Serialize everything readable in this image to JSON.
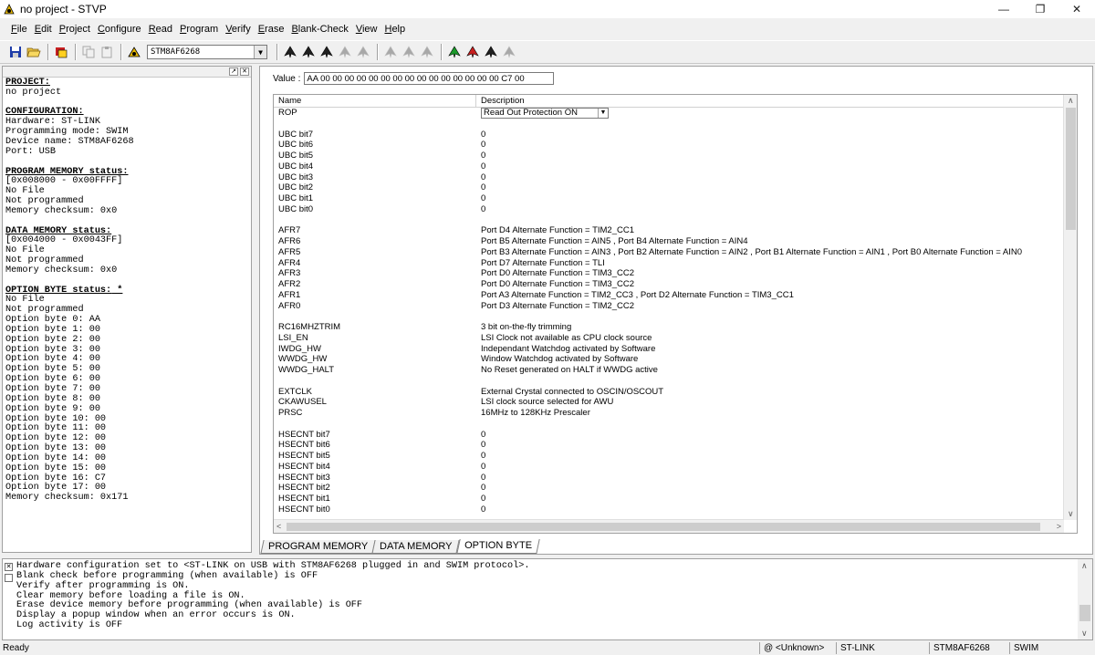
{
  "window": {
    "title": "no project - STVP"
  },
  "menu": [
    "File",
    "Edit",
    "Project",
    "Configure",
    "Read",
    "Program",
    "Verify",
    "Erase",
    "Blank-Check",
    "View",
    "Help"
  ],
  "toolbar": {
    "device": "STM8AF6268"
  },
  "left_panel": {
    "sections": [
      {
        "title": "PROJECT:",
        "lines": [
          "no project"
        ]
      },
      {
        "title": "CONFIGURATION:",
        "lines": [
          "Hardware: ST-LINK",
          "Programming mode: SWIM",
          "Device name: STM8AF6268",
          "Port: USB"
        ]
      },
      {
        "title": "PROGRAM MEMORY status:",
        "lines": [
          "[0x008000 - 0x00FFFF]",
          "No File",
          "Not programmed",
          "Memory checksum: 0x0"
        ]
      },
      {
        "title": "DATA MEMORY status:",
        "lines": [
          "[0x004000 - 0x0043FF]",
          "No File",
          "Not programmed",
          "Memory checksum: 0x0"
        ]
      },
      {
        "title": "OPTION BYTE status:",
        "suffix": " *",
        "lines": [
          "No File",
          "Not programmed",
          "Option byte 0: AA",
          "Option byte 1: 00",
          "Option byte 2: 00",
          "Option byte 3: 00",
          "Option byte 4: 00",
          "Option byte 5: 00",
          "Option byte 6: 00",
          "Option byte 7: 00",
          "Option byte 8: 00",
          "Option byte 9: 00",
          "Option byte 10: 00",
          "Option byte 11: 00",
          "Option byte 12: 00",
          "Option byte 13: 00",
          "Option byte 14: 00",
          "Option byte 15: 00",
          "Option byte 16: C7",
          "Option byte 17: 00",
          "Memory checksum: 0x171"
        ]
      }
    ]
  },
  "value_row": {
    "label": "Value :",
    "value": "AA 00 00 00 00 00 00 00 00 00 00 00 00 00 00 00 C7 00"
  },
  "table": {
    "col_name": "Name",
    "col_desc": "Description",
    "rows": [
      {
        "name": "ROP",
        "desc": "Read Out Protection ON",
        "select": true
      },
      {
        "name": "",
        "desc": ""
      },
      {
        "name": "UBC bit7",
        "desc": "0"
      },
      {
        "name": "UBC bit6",
        "desc": "0"
      },
      {
        "name": "UBC bit5",
        "desc": "0"
      },
      {
        "name": "UBC bit4",
        "desc": "0"
      },
      {
        "name": "UBC bit3",
        "desc": "0"
      },
      {
        "name": "UBC bit2",
        "desc": "0"
      },
      {
        "name": "UBC bit1",
        "desc": "0"
      },
      {
        "name": "UBC bit0",
        "desc": "0"
      },
      {
        "name": "",
        "desc": ""
      },
      {
        "name": "AFR7",
        "desc": "Port D4 Alternate Function = TIM2_CC1"
      },
      {
        "name": "AFR6",
        "desc": "Port B5 Alternate Function = AIN5 , Port B4 Alternate Function = AIN4"
      },
      {
        "name": "AFR5",
        "desc": "Port B3 Alternate Function = AIN3 , Port B2 Alternate Function = AIN2 , Port B1 Alternate Function = AIN1 , Port B0 Alternate Function = AIN0"
      },
      {
        "name": "AFR4",
        "desc": "Port D7 Alternate Function = TLI"
      },
      {
        "name": "AFR3",
        "desc": "Port D0 Alternate Function = TIM3_CC2"
      },
      {
        "name": "AFR2",
        "desc": "Port D0 Alternate Function = TIM3_CC2"
      },
      {
        "name": "AFR1",
        "desc": "Port A3 Alternate Function = TIM2_CC3 , Port D2 Alternate Function = TIM3_CC1"
      },
      {
        "name": "AFR0",
        "desc": "Port D3 Alternate Function = TIM2_CC2"
      },
      {
        "name": "",
        "desc": ""
      },
      {
        "name": "RC16MHZTRIM",
        "desc": "3 bit on-the-fly trimming"
      },
      {
        "name": "LSI_EN",
        "desc": "LSI Clock not available as CPU clock source"
      },
      {
        "name": "IWDG_HW",
        "desc": "Independant Watchdog activated by Software"
      },
      {
        "name": "WWDG_HW",
        "desc": "Window Watchdog activated by Software"
      },
      {
        "name": "WWDG_HALT",
        "desc": "No Reset generated on HALT if WWDG active"
      },
      {
        "name": "",
        "desc": ""
      },
      {
        "name": "EXTCLK",
        "desc": "External Crystal connected to OSCIN/OSCOUT"
      },
      {
        "name": "CKAWUSEL",
        "desc": "LSI clock source selected for AWU"
      },
      {
        "name": "PRSC",
        "desc": "16MHz to 128KHz Prescaler"
      },
      {
        "name": "",
        "desc": ""
      },
      {
        "name": "HSECNT bit7",
        "desc": "0"
      },
      {
        "name": "HSECNT bit6",
        "desc": "0"
      },
      {
        "name": "HSECNT bit5",
        "desc": "0"
      },
      {
        "name": "HSECNT bit4",
        "desc": "0"
      },
      {
        "name": "HSECNT bit3",
        "desc": "0"
      },
      {
        "name": "HSECNT bit2",
        "desc": "0"
      },
      {
        "name": "HSECNT bit1",
        "desc": "0"
      },
      {
        "name": "HSECNT bit0",
        "desc": "0"
      }
    ]
  },
  "tabs": [
    "PROGRAM MEMORY",
    "DATA MEMORY",
    "OPTION BYTE"
  ],
  "active_tab": "OPTION BYTE",
  "log": [
    "Hardware configuration set to <ST-LINK on USB with STM8AF6268 plugged in and SWIM protocol>.",
    "Blank check before programming (when available) is OFF",
    "Verify after programming is ON.",
    "Clear memory before loading a file is ON.",
    "Erase device memory before programming (when available) is OFF",
    "Display a popup window when an error occurs is ON.",
    "Log activity is OFF"
  ],
  "status": {
    "ready": "Ready",
    "location": "@ <Unknown>",
    "tool": "ST-LINK",
    "device": "STM8AF6268",
    "protocol": "SWIM"
  },
  "colors": {
    "green": "#1a9a2a",
    "red": "#c81e1e",
    "dark": "#202020",
    "disabled": "#a8a8a8"
  }
}
